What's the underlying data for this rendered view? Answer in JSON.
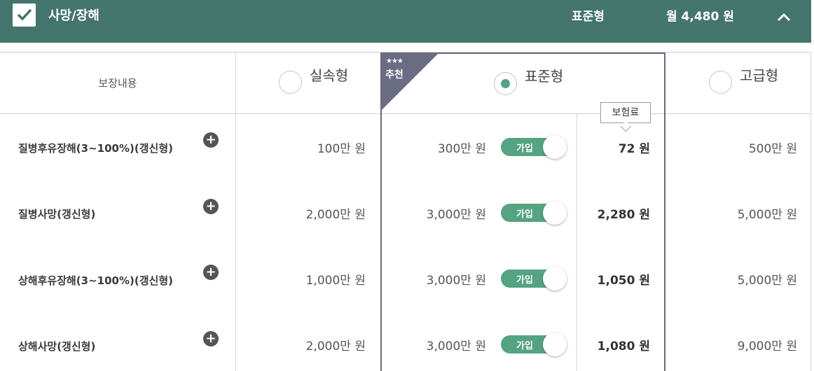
{
  "header": {
    "title": "사망/장해",
    "selected_plan": "표준형",
    "monthly_total": "월 4,480 원",
    "accent_color": "#43756c"
  },
  "table": {
    "coverage_header": "보장내용",
    "plans": [
      {
        "label": "실속형",
        "selected": false
      },
      {
        "label": "표준형",
        "selected": true
      },
      {
        "label": "고급형",
        "selected": false
      }
    ],
    "recommend": {
      "stars": "★★★",
      "label": "추천"
    },
    "premium_tooltip": "보험료",
    "rows": [
      {
        "name": "질병후유장해(3~100%)(갱신형)",
        "basic": "100만 원",
        "standard": "300만 원",
        "toggle": "가입",
        "premium": "72 원",
        "premium_plan": "500만 원"
      },
      {
        "name": "질병사망(갱신형)",
        "basic": "2,000만 원",
        "standard": "3,000만 원",
        "toggle": "가입",
        "premium": "2,280 원",
        "premium_plan": "5,000만 원"
      },
      {
        "name": "상해후유장해(3~100%)(갱신형)",
        "basic": "1,000만 원",
        "standard": "3,000만 원",
        "toggle": "가입",
        "premium": "1,050 원",
        "premium_plan": "5,000만 원"
      },
      {
        "name": "상해사망(갱신형)",
        "basic": "2,000만 원",
        "standard": "3,000만 원",
        "toggle": "가입",
        "premium": "1,080 원",
        "premium_plan": "9,000만 원"
      }
    ]
  }
}
